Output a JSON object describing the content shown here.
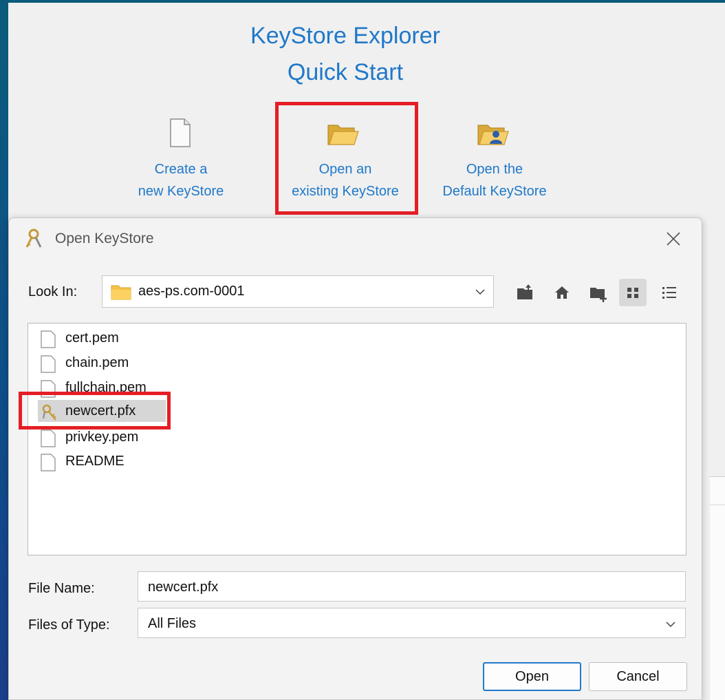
{
  "quick_start": {
    "title_line1": "KeyStore Explorer",
    "title_line2": "Quick Start",
    "items": [
      {
        "line1": "Create a",
        "line2": "new KeyStore",
        "icon": "blank-document-icon"
      },
      {
        "line1": "Open an",
        "line2": "existing KeyStore",
        "icon": "open-folder-icon"
      },
      {
        "line1": "Open the",
        "line2": "Default KeyStore",
        "icon": "user-folder-icon"
      }
    ]
  },
  "dialog": {
    "title": "Open KeyStore",
    "look_in_label": "Look In:",
    "look_in_value": "aes-ps.com-0001",
    "toolbar": [
      "up-folder-icon",
      "home-icon",
      "new-folder-icon",
      "list-view-icon",
      "details-view-icon"
    ],
    "files": [
      {
        "name": "cert.pem",
        "icon": "file-icon"
      },
      {
        "name": "chain.pem",
        "icon": "file-icon"
      },
      {
        "name": "fullchain.pem",
        "icon": "file-icon"
      },
      {
        "name": "newcert.pfx",
        "icon": "keystore-icon",
        "selected": true
      },
      {
        "name": "privkey.pem",
        "icon": "file-icon"
      },
      {
        "name": "README",
        "icon": "file-icon"
      }
    ],
    "file_name_label": "File Name:",
    "file_name_value": "newcert.pfx",
    "files_of_type_label": "Files of Type:",
    "files_of_type_value": "All Files",
    "open_label": "Open",
    "cancel_label": "Cancel"
  },
  "colors": {
    "accent": "#1f78c9",
    "highlight_red": "#e51e25",
    "desktop": "#0e4f8a"
  }
}
